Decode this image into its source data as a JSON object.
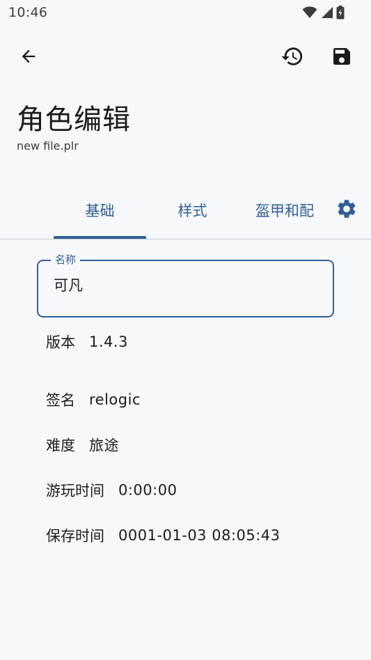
{
  "status_bar": {
    "time": "10:46",
    "icons": [
      "wifi-icon",
      "cellular-signal-icon",
      "battery-charging-icon"
    ]
  },
  "app_bar": {
    "back_icon": "arrow-back-icon",
    "history_icon": "history-icon",
    "save_icon": "save-icon",
    "title": "角色编辑",
    "subtitle": "new file.plr"
  },
  "tabs": {
    "items": [
      {
        "label": "基础",
        "selected": true
      },
      {
        "label": "样式",
        "selected": false
      },
      {
        "label": "盔甲和配",
        "selected": false
      }
    ],
    "settings_icon": "gear-icon"
  },
  "name_field": {
    "label": "名称",
    "value": "可凡"
  },
  "info": [
    {
      "label": "版本",
      "value": "1.4.3"
    },
    {
      "label": "签名",
      "value": "relogic"
    },
    {
      "label": "难度",
      "value": "旅途"
    },
    {
      "label": "游玩时间",
      "value": "0:00:00"
    },
    {
      "label": "保存时间",
      "value": "0001-01-03 08:05:43"
    }
  ],
  "colors": {
    "accent": "#305f94",
    "background": "#f7f8fc",
    "text": "#1b1b1f"
  }
}
